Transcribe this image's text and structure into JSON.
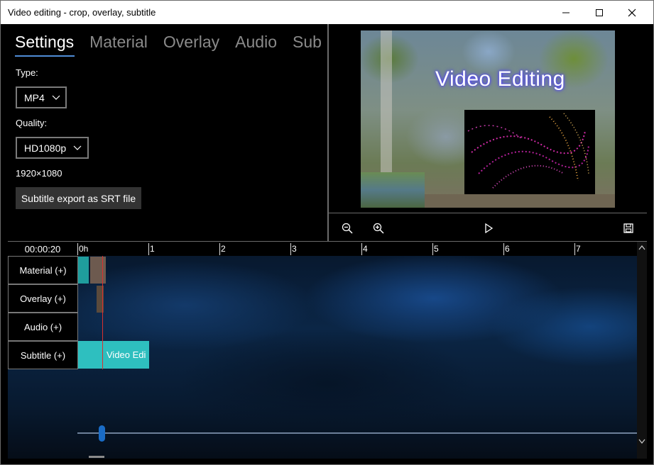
{
  "window": {
    "title": "Video editing - crop, overlay, subtitle"
  },
  "tabs": [
    "Settings",
    "Material",
    "Overlay",
    "Audio",
    "Sub"
  ],
  "settings": {
    "type_label": "Type:",
    "type_value": "MP4",
    "quality_label": "Quality:",
    "quality_value": "HD1080p",
    "resolution": "1920×1080",
    "export_button": "Subtitle export as SRT file"
  },
  "preview": {
    "overlay_text": "Video Editing"
  },
  "timeline": {
    "current_time": "00:00:20",
    "ruler_labels": [
      "0h",
      "1",
      "2",
      "3",
      "4",
      "5",
      "6",
      "7"
    ],
    "tracks": [
      "Material (+)",
      "Overlay (+)",
      "Audio (+)",
      "Subtitle (+)"
    ],
    "subtitle_clip_text": "Video Edi"
  },
  "icons": {
    "minimize": "minimize-icon",
    "maximize": "maximize-icon",
    "close": "close-icon",
    "zoom_out": "zoom-out-icon",
    "zoom_in": "zoom-in-icon",
    "play": "play-icon",
    "save": "save-icon"
  },
  "colors": {
    "accent": "#4f8cd6",
    "clip": "#2ebfbf",
    "playhead": "#d83030"
  }
}
